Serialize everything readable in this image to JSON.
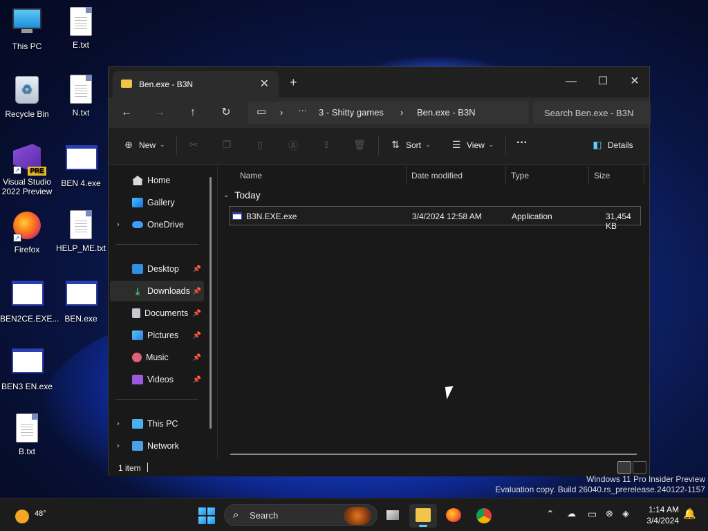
{
  "desktop": {
    "icons": [
      {
        "label": "This PC",
        "icon": "computer-icon"
      },
      {
        "label": "E.txt",
        "icon": "text-file-icon"
      },
      {
        "label": "Recycle Bin",
        "icon": "recycle-bin-icon"
      },
      {
        "label": "N.txt",
        "icon": "text-file-icon"
      },
      {
        "label": "Visual Studio 2022 Preview",
        "icon": "visual-studio-icon",
        "badge": "PRE"
      },
      {
        "label": "BEN 4.exe",
        "icon": "application-icon"
      },
      {
        "label": "Firefox",
        "icon": "firefox-icon"
      },
      {
        "label": "HELP_ME.txt",
        "icon": "text-file-icon"
      },
      {
        "label": "BEN2CE.EXE...",
        "icon": "application-icon"
      },
      {
        "label": "BEN.exe",
        "icon": "application-icon"
      },
      {
        "label": "BEN3 EN.exe",
        "icon": "application-icon"
      },
      {
        "label": "B.txt",
        "icon": "text-file-icon"
      }
    ]
  },
  "window": {
    "tab_title": "Ben.exe - B3N",
    "breadcrumb": {
      "more": "···",
      "parent": "3 - Shitty games",
      "current": "Ben.exe - B3N"
    },
    "search_placeholder": "Search Ben.exe - B3N",
    "commands": {
      "new": "New",
      "sort": "Sort",
      "view": "View",
      "more": "···",
      "details": "Details"
    },
    "nav": {
      "home": "Home",
      "gallery": "Gallery",
      "onedrive": "OneDrive",
      "desktop": "Desktop",
      "downloads": "Downloads",
      "documents": "Documents",
      "pictures": "Pictures",
      "music": "Music",
      "videos": "Videos",
      "thispc": "This PC",
      "network": "Network"
    },
    "columns": {
      "name": "Name",
      "date": "Date modified",
      "type": "Type",
      "size": "Size"
    },
    "group": "Today",
    "files": [
      {
        "name": "B3N.EXE.exe",
        "date": "3/4/2024 12:58 AM",
        "type": "Application",
        "size": "31,454 KB"
      }
    ],
    "status": "1 item"
  },
  "watermark": {
    "line1": "Windows 11 Pro Insider Preview",
    "line2": "Evaluation copy. Build 26040.rs_prerelease.240122-1157"
  },
  "taskbar": {
    "weather_temp": "48°",
    "search_label": "Search",
    "time": "1:14 AM",
    "date": "3/4/2024"
  },
  "colors": {
    "accent": "#60cdff",
    "folder": "#f2c44a",
    "window_bg": "#191919"
  }
}
